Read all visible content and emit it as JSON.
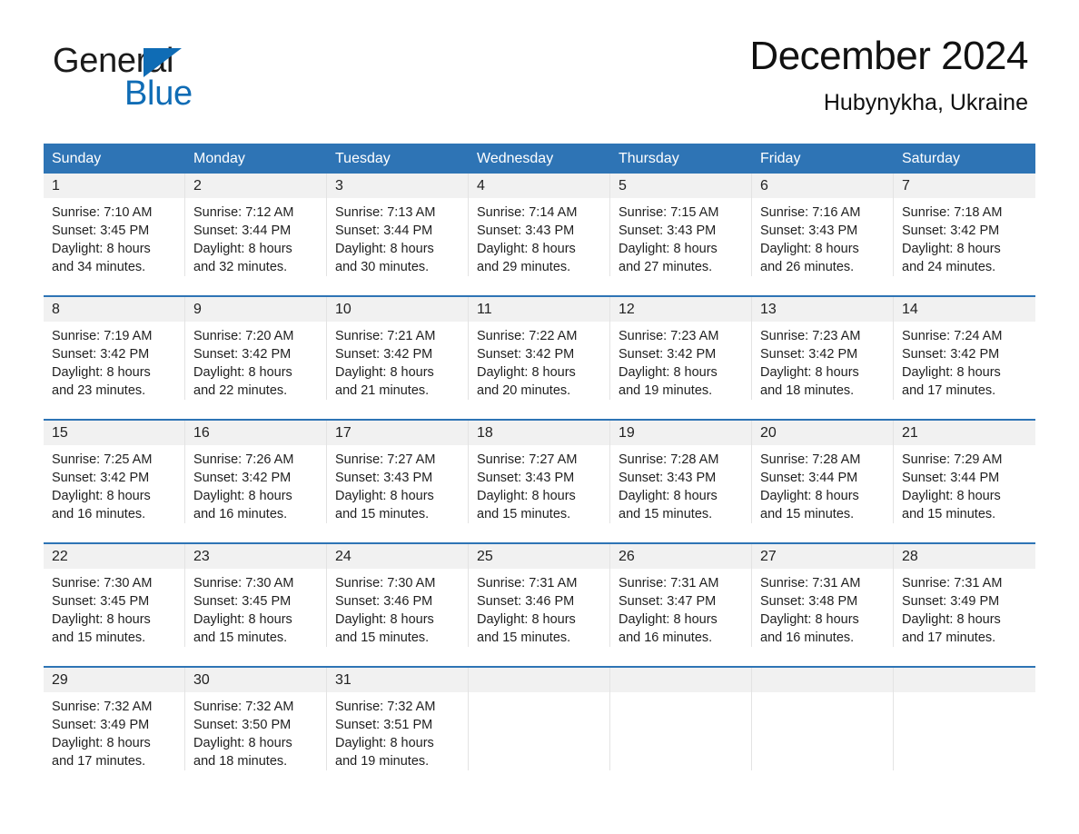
{
  "brand": {
    "name_part1": "General",
    "name_part2": "Blue",
    "logo_icon": "triangle-logo-icon",
    "accent_color": "#0f6cb5"
  },
  "header": {
    "title": "December 2024",
    "subtitle": "Hubynykha, Ukraine"
  },
  "theme": {
    "header_blue": "#2e74b5",
    "daynum_band": "#f1f1f1",
    "cell_divider": "#e3e3e3"
  },
  "calendar": {
    "weekday_headers": [
      "Sunday",
      "Monday",
      "Tuesday",
      "Wednesday",
      "Thursday",
      "Friday",
      "Saturday"
    ],
    "weeks": [
      [
        {
          "day": "1",
          "sunrise": "Sunrise: 7:10 AM",
          "sunset": "Sunset: 3:45 PM",
          "daylight1": "Daylight: 8 hours",
          "daylight2": "and 34 minutes."
        },
        {
          "day": "2",
          "sunrise": "Sunrise: 7:12 AM",
          "sunset": "Sunset: 3:44 PM",
          "daylight1": "Daylight: 8 hours",
          "daylight2": "and 32 minutes."
        },
        {
          "day": "3",
          "sunrise": "Sunrise: 7:13 AM",
          "sunset": "Sunset: 3:44 PM",
          "daylight1": "Daylight: 8 hours",
          "daylight2": "and 30 minutes."
        },
        {
          "day": "4",
          "sunrise": "Sunrise: 7:14 AM",
          "sunset": "Sunset: 3:43 PM",
          "daylight1": "Daylight: 8 hours",
          "daylight2": "and 29 minutes."
        },
        {
          "day": "5",
          "sunrise": "Sunrise: 7:15 AM",
          "sunset": "Sunset: 3:43 PM",
          "daylight1": "Daylight: 8 hours",
          "daylight2": "and 27 minutes."
        },
        {
          "day": "6",
          "sunrise": "Sunrise: 7:16 AM",
          "sunset": "Sunset: 3:43 PM",
          "daylight1": "Daylight: 8 hours",
          "daylight2": "and 26 minutes."
        },
        {
          "day": "7",
          "sunrise": "Sunrise: 7:18 AM",
          "sunset": "Sunset: 3:42 PM",
          "daylight1": "Daylight: 8 hours",
          "daylight2": "and 24 minutes."
        }
      ],
      [
        {
          "day": "8",
          "sunrise": "Sunrise: 7:19 AM",
          "sunset": "Sunset: 3:42 PM",
          "daylight1": "Daylight: 8 hours",
          "daylight2": "and 23 minutes."
        },
        {
          "day": "9",
          "sunrise": "Sunrise: 7:20 AM",
          "sunset": "Sunset: 3:42 PM",
          "daylight1": "Daylight: 8 hours",
          "daylight2": "and 22 minutes."
        },
        {
          "day": "10",
          "sunrise": "Sunrise: 7:21 AM",
          "sunset": "Sunset: 3:42 PM",
          "daylight1": "Daylight: 8 hours",
          "daylight2": "and 21 minutes."
        },
        {
          "day": "11",
          "sunrise": "Sunrise: 7:22 AM",
          "sunset": "Sunset: 3:42 PM",
          "daylight1": "Daylight: 8 hours",
          "daylight2": "and 20 minutes."
        },
        {
          "day": "12",
          "sunrise": "Sunrise: 7:23 AM",
          "sunset": "Sunset: 3:42 PM",
          "daylight1": "Daylight: 8 hours",
          "daylight2": "and 19 minutes."
        },
        {
          "day": "13",
          "sunrise": "Sunrise: 7:23 AM",
          "sunset": "Sunset: 3:42 PM",
          "daylight1": "Daylight: 8 hours",
          "daylight2": "and 18 minutes."
        },
        {
          "day": "14",
          "sunrise": "Sunrise: 7:24 AM",
          "sunset": "Sunset: 3:42 PM",
          "daylight1": "Daylight: 8 hours",
          "daylight2": "and 17 minutes."
        }
      ],
      [
        {
          "day": "15",
          "sunrise": "Sunrise: 7:25 AM",
          "sunset": "Sunset: 3:42 PM",
          "daylight1": "Daylight: 8 hours",
          "daylight2": "and 16 minutes."
        },
        {
          "day": "16",
          "sunrise": "Sunrise: 7:26 AM",
          "sunset": "Sunset: 3:42 PM",
          "daylight1": "Daylight: 8 hours",
          "daylight2": "and 16 minutes."
        },
        {
          "day": "17",
          "sunrise": "Sunrise: 7:27 AM",
          "sunset": "Sunset: 3:43 PM",
          "daylight1": "Daylight: 8 hours",
          "daylight2": "and 15 minutes."
        },
        {
          "day": "18",
          "sunrise": "Sunrise: 7:27 AM",
          "sunset": "Sunset: 3:43 PM",
          "daylight1": "Daylight: 8 hours",
          "daylight2": "and 15 minutes."
        },
        {
          "day": "19",
          "sunrise": "Sunrise: 7:28 AM",
          "sunset": "Sunset: 3:43 PM",
          "daylight1": "Daylight: 8 hours",
          "daylight2": "and 15 minutes."
        },
        {
          "day": "20",
          "sunrise": "Sunrise: 7:28 AM",
          "sunset": "Sunset: 3:44 PM",
          "daylight1": "Daylight: 8 hours",
          "daylight2": "and 15 minutes."
        },
        {
          "day": "21",
          "sunrise": "Sunrise: 7:29 AM",
          "sunset": "Sunset: 3:44 PM",
          "daylight1": "Daylight: 8 hours",
          "daylight2": "and 15 minutes."
        }
      ],
      [
        {
          "day": "22",
          "sunrise": "Sunrise: 7:30 AM",
          "sunset": "Sunset: 3:45 PM",
          "daylight1": "Daylight: 8 hours",
          "daylight2": "and 15 minutes."
        },
        {
          "day": "23",
          "sunrise": "Sunrise: 7:30 AM",
          "sunset": "Sunset: 3:45 PM",
          "daylight1": "Daylight: 8 hours",
          "daylight2": "and 15 minutes."
        },
        {
          "day": "24",
          "sunrise": "Sunrise: 7:30 AM",
          "sunset": "Sunset: 3:46 PM",
          "daylight1": "Daylight: 8 hours",
          "daylight2": "and 15 minutes."
        },
        {
          "day": "25",
          "sunrise": "Sunrise: 7:31 AM",
          "sunset": "Sunset: 3:46 PM",
          "daylight1": "Daylight: 8 hours",
          "daylight2": "and 15 minutes."
        },
        {
          "day": "26",
          "sunrise": "Sunrise: 7:31 AM",
          "sunset": "Sunset: 3:47 PM",
          "daylight1": "Daylight: 8 hours",
          "daylight2": "and 16 minutes."
        },
        {
          "day": "27",
          "sunrise": "Sunrise: 7:31 AM",
          "sunset": "Sunset: 3:48 PM",
          "daylight1": "Daylight: 8 hours",
          "daylight2": "and 16 minutes."
        },
        {
          "day": "28",
          "sunrise": "Sunrise: 7:31 AM",
          "sunset": "Sunset: 3:49 PM",
          "daylight1": "Daylight: 8 hours",
          "daylight2": "and 17 minutes."
        }
      ],
      [
        {
          "day": "29",
          "sunrise": "Sunrise: 7:32 AM",
          "sunset": "Sunset: 3:49 PM",
          "daylight1": "Daylight: 8 hours",
          "daylight2": "and 17 minutes."
        },
        {
          "day": "30",
          "sunrise": "Sunrise: 7:32 AM",
          "sunset": "Sunset: 3:50 PM",
          "daylight1": "Daylight: 8 hours",
          "daylight2": "and 18 minutes."
        },
        {
          "day": "31",
          "sunrise": "Sunrise: 7:32 AM",
          "sunset": "Sunset: 3:51 PM",
          "daylight1": "Daylight: 8 hours",
          "daylight2": "and 19 minutes."
        },
        {
          "day": "",
          "sunrise": "",
          "sunset": "",
          "daylight1": "",
          "daylight2": ""
        },
        {
          "day": "",
          "sunrise": "",
          "sunset": "",
          "daylight1": "",
          "daylight2": ""
        },
        {
          "day": "",
          "sunrise": "",
          "sunset": "",
          "daylight1": "",
          "daylight2": ""
        },
        {
          "day": "",
          "sunrise": "",
          "sunset": "",
          "daylight1": "",
          "daylight2": ""
        }
      ]
    ]
  }
}
